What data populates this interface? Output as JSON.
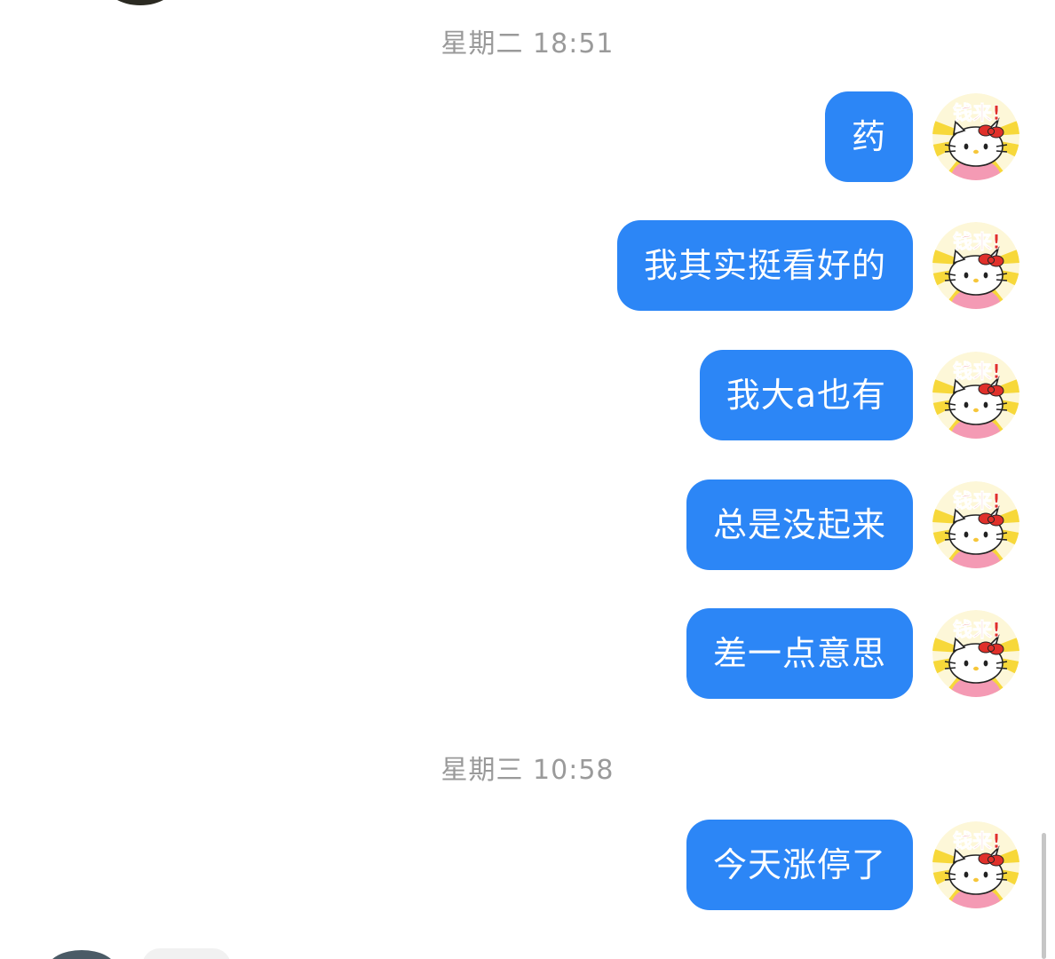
{
  "chat": {
    "timestamp_1": "星期二 18:51",
    "timestamp_2": "星期三 10:58",
    "messages": [
      {
        "text": "药"
      },
      {
        "text": "我其实挺看好的"
      },
      {
        "text": "我大a也有"
      },
      {
        "text": "总是没起来"
      },
      {
        "text": "差一点意思"
      },
      {
        "text": "今天涨停了"
      }
    ],
    "avatar": {
      "icon": "hello-kitty-avatar-icon",
      "sticker_text": "钱来!"
    }
  },
  "colors": {
    "bubble_outgoing": "#2c86f6",
    "bubble_text": "#ffffff",
    "timestamp_text": "#9a9a9a",
    "background": "#ffffff"
  }
}
